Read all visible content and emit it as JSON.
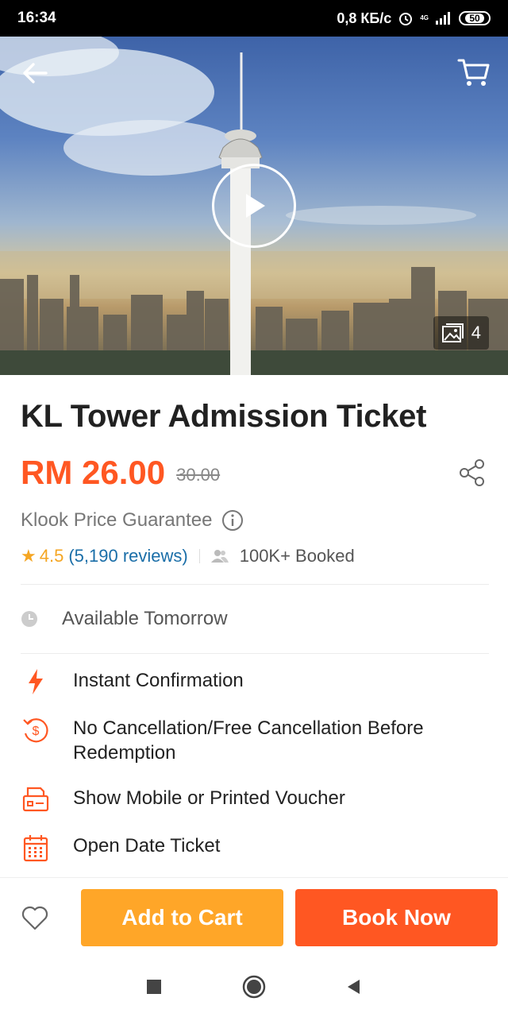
{
  "status_bar": {
    "time": "16:34",
    "speed": "0,8 КБ/с",
    "network": "4G",
    "battery": "50"
  },
  "hero": {
    "gallery_count": "4"
  },
  "product": {
    "title": "KL Tower Admission Ticket",
    "price": "RM 26.00",
    "original_price": "30.00",
    "guarantee": "Klook Price Guarantee",
    "rating": "4.5",
    "reviews": "(5,190 reviews)",
    "booked": "100K+ Booked",
    "availability": "Available Tomorrow"
  },
  "features": [
    {
      "icon": "lightning-icon",
      "label": "Instant Confirmation"
    },
    {
      "icon": "refund-icon",
      "label": "No Cancellation/Free Cancellation Before Redemption"
    },
    {
      "icon": "voucher-icon",
      "label": "Show Mobile or Printed Voucher"
    },
    {
      "icon": "calendar-icon",
      "label": "Open Date Ticket"
    }
  ],
  "actions": {
    "add_to_cart": "Add to Cart",
    "book_now": "Book Now"
  },
  "colors": {
    "accent": "#ff5722",
    "secondary": "#ffa628",
    "link": "#1a6ea8",
    "star": "#f5a623"
  }
}
